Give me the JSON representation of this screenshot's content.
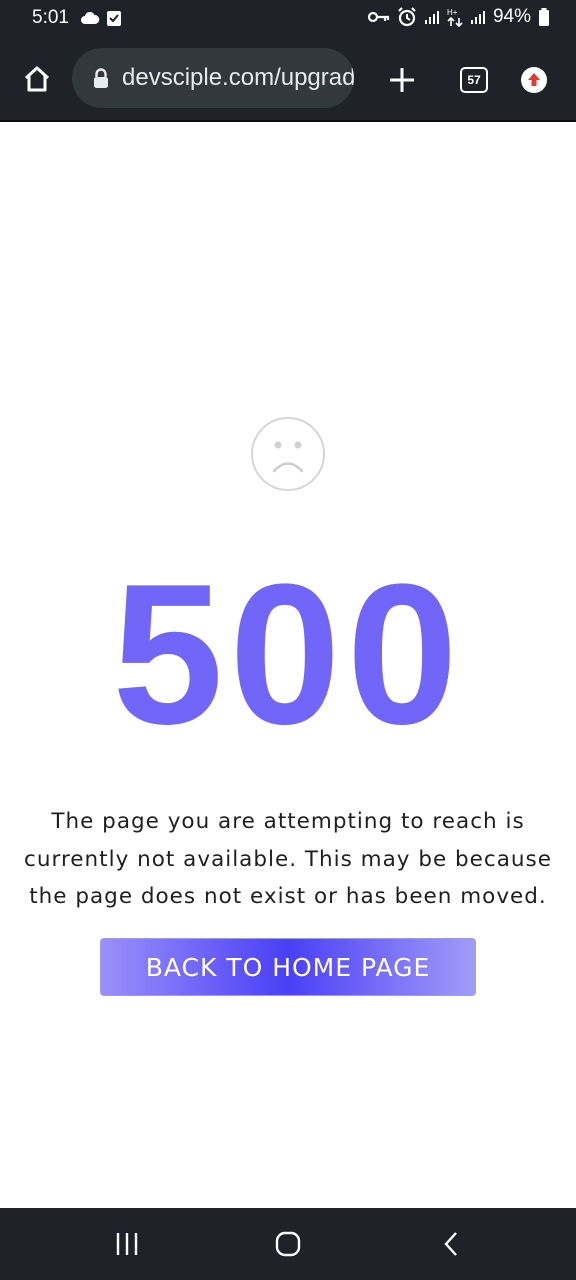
{
  "status_bar": {
    "time": "5:01",
    "battery": "94%"
  },
  "browser": {
    "url": "devsciple.com/upgrade",
    "tab_count": "57"
  },
  "page": {
    "error_code": "500",
    "message": "The page you are attempting to reach is currently not available. This may be because the page does not exist or has been moved.",
    "button_label": "BACK TO HOME PAGE"
  },
  "colors": {
    "accent": "#7266f8",
    "button_gradient_center": "#4a3ff5",
    "chrome_dark": "#1f2327"
  },
  "icons": {
    "status_left": [
      "cloud-icon",
      "check-box-icon"
    ],
    "status_right": [
      "key-icon",
      "alarm-icon",
      "signal-icon",
      "data-arrows-icon",
      "signal-icon",
      "battery-icon"
    ],
    "toolbar": [
      "home-icon",
      "lock-icon",
      "plus-icon",
      "tab-switcher-icon",
      "update-arrow-icon"
    ],
    "page": [
      "sad-face-icon"
    ],
    "nav": [
      "recent-apps-icon",
      "home-circle-icon",
      "back-chevron-icon"
    ]
  }
}
